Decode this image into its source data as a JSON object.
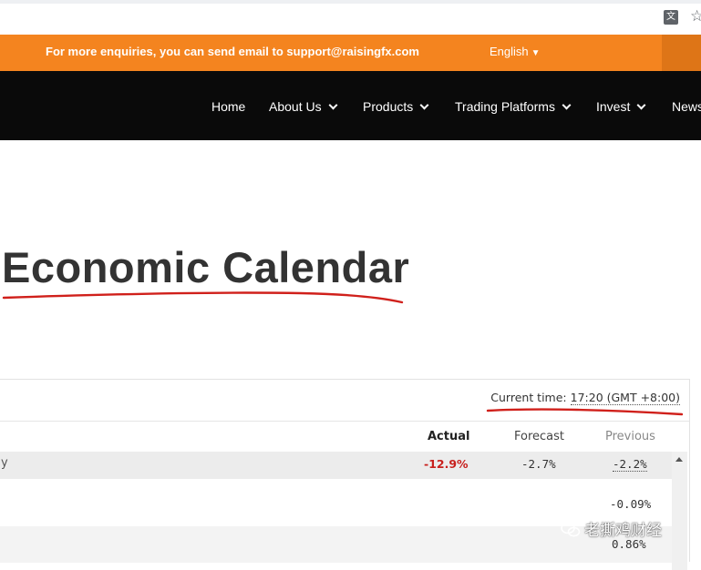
{
  "info_bar": {
    "message": "For more enquiries, you can send email to support@raisingfx.com",
    "language": "English",
    "language_arrow": "▼"
  },
  "nav": {
    "items": [
      {
        "label": "Home",
        "has_dropdown": false
      },
      {
        "label": "About Us",
        "has_dropdown": true
      },
      {
        "label": "Products",
        "has_dropdown": true
      },
      {
        "label": "Trading Platforms",
        "has_dropdown": true
      },
      {
        "label": "Invest",
        "has_dropdown": true
      },
      {
        "label": "News",
        "has_dropdown": false
      }
    ]
  },
  "page": {
    "title": "Economic Calendar"
  },
  "calendar": {
    "current_time_label": "Current time:",
    "current_time_value": "17:20 (GMT +8:00)",
    "columns": {
      "actual": "Actual",
      "forecast": "Forecast",
      "previous": "Previous"
    },
    "rows": [
      {
        "tail": "y",
        "actual": "-12.9%",
        "forecast": "-2.7%",
        "previous": "-2.2%"
      },
      {
        "tail": "",
        "actual": "",
        "forecast": "",
        "previous": "-0.09%"
      },
      {
        "tail": "",
        "actual": "",
        "forecast": "",
        "previous": "0.86%"
      }
    ]
  },
  "watermark": {
    "text": "老撕鸡财经"
  },
  "colors": {
    "info_bar": "#f4841f",
    "nav_bar": "#0a0a0a",
    "actual_negative": "#c8201d",
    "annotation": "#d0201b"
  },
  "icons": [
    "translate-icon",
    "star-icon",
    "chevron-down-icon",
    "scroll-up-arrow-icon",
    "wechat-icon"
  ]
}
